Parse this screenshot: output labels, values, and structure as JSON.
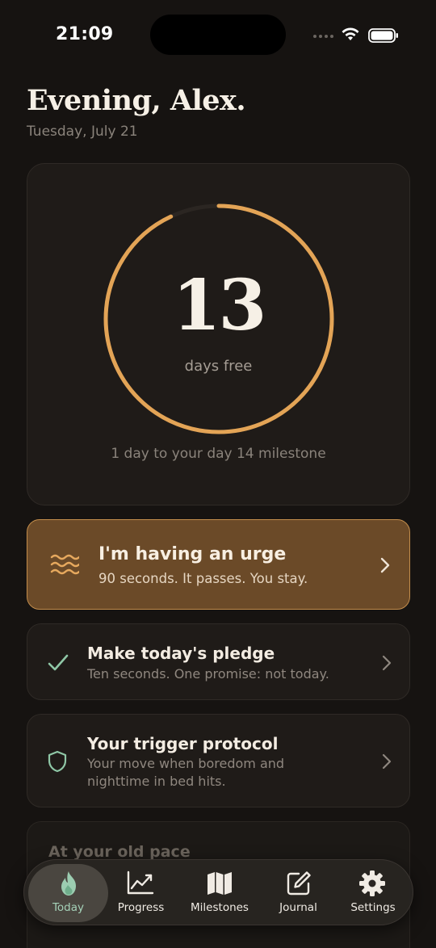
{
  "status_bar": {
    "time": "21:09"
  },
  "header": {
    "greeting": "Evening, Alex.",
    "date": "Tuesday, July 21"
  },
  "streak": {
    "count": "13",
    "label": "days free",
    "milestone_text": "1 day to your day 14 milestone",
    "progress_fraction": 0.93
  },
  "urge_card": {
    "title": "I'm having an urge",
    "subtitle": "90 seconds. It passes. You stay.",
    "icon": "waves-icon"
  },
  "pledge_card": {
    "title": "Make today's pledge",
    "subtitle": "Ten seconds. One promise: not today.",
    "icon": "check-icon"
  },
  "protocol_card": {
    "title": "Your trigger protocol",
    "subtitle": "Your move when boredom and nighttime in bed hits.",
    "icon": "shield-icon"
  },
  "pace_card": {
    "title": "At your old pace"
  },
  "tabbar": {
    "tabs": [
      {
        "label": "Today",
        "icon": "flame-icon",
        "active": true
      },
      {
        "label": "Progress",
        "icon": "chart-icon",
        "active": false
      },
      {
        "label": "Milestones",
        "icon": "map-icon",
        "active": false
      },
      {
        "label": "Journal",
        "icon": "pencil-square-icon",
        "active": false
      },
      {
        "label": "Settings",
        "icon": "gear-icon",
        "active": false
      }
    ]
  },
  "colors": {
    "background": "#161311",
    "accent": "#e3a456",
    "urge_card": "#6b4a28",
    "active_tab": "#a5d1b8"
  }
}
